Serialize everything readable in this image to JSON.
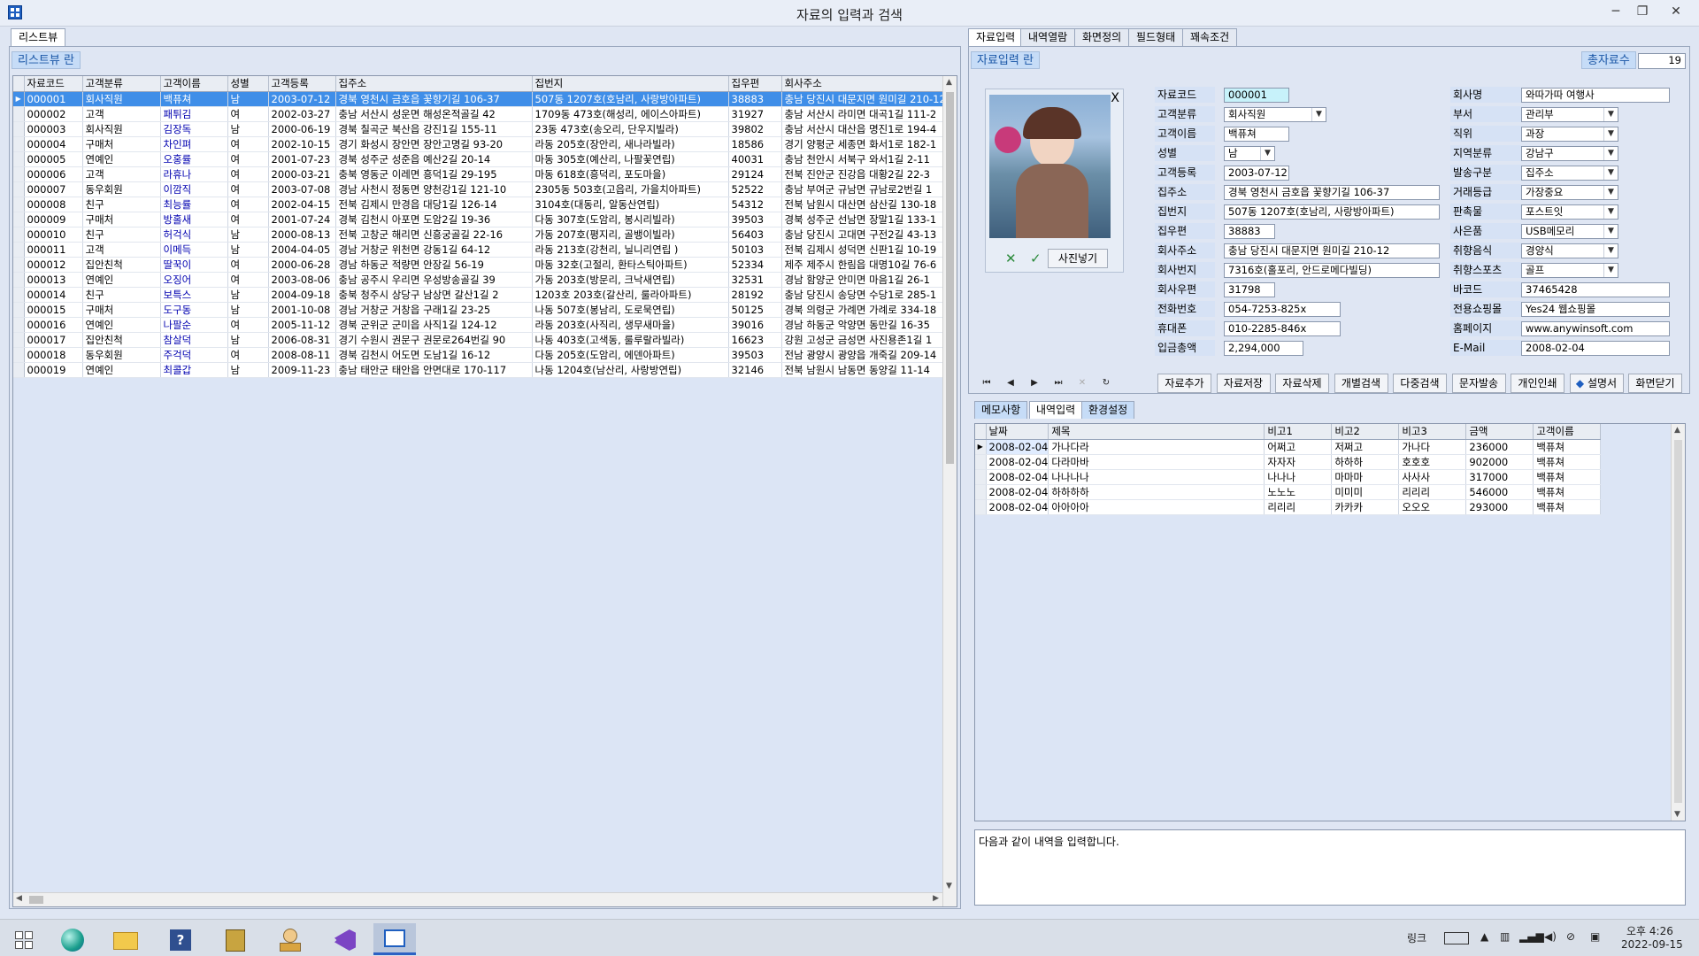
{
  "window": {
    "title": "자료의 입력과 검색",
    "controls": [
      "─",
      "❐",
      "✕"
    ]
  },
  "left": {
    "tab": "리스트뷰",
    "panel_label": "리스트뷰 란",
    "columns": [
      "자료코드",
      "고객분류",
      "고객이름",
      "성별",
      "고객등록",
      "집주소",
      "집번지",
      "집우편",
      "회사주소"
    ],
    "rows": [
      [
        "000001",
        "회사직원",
        "백퓨쳐",
        "남",
        "2003-07-12",
        "경북 영천시 금호읍 꽃향기길 106-37",
        "507동 1207호(호남리, 사랑방아파트)",
        "38883",
        "충남 당진시 대문지면 원미길 210-12"
      ],
      [
        "000002",
        "고객",
        "패튀김",
        "여",
        "2002-03-27",
        "충남 서산시 성운면 해성온적골길 42",
        "1709동 473호(해성리, 에이스아파트)",
        "31927",
        "충남 서산시 라미면 대곡1길 111-2"
      ],
      [
        "000003",
        "회사직원",
        "김장독",
        "남",
        "2000-06-19",
        "경북 칠곡군 북산읍 강진1길 155-11",
        "23동 473호(송오리, 단우지빌라)",
        "39802",
        "충남 서산시 대산읍 명진1로 194-4"
      ],
      [
        "000004",
        "구매처",
        "차인펴",
        "여",
        "2002-10-15",
        "경기 화성시 장안면 장안고명길 93-20",
        "라동 205호(장안리, 새나라빌라)",
        "18586",
        "경기 양평군 세종면 화서1로 182-1"
      ],
      [
        "000005",
        "연예인",
        "오홍률",
        "여",
        "2001-07-23",
        "경북 성주군 성준읍 예산2길 20-14",
        "마동 305호(예산리, 나팔꽃연립)",
        "40031",
        "충남 천안시 서북구 와서1길 2-11"
      ],
      [
        "000006",
        "고객",
        "라휴나",
        "여",
        "2000-03-21",
        "충북 영동군 이레면 흥덕1길 29-195",
        "마동 618호(흥덕리, 포도마을)",
        "29124",
        "전북 진안군 진강읍 대황2길 22-3"
      ],
      [
        "000007",
        "동우회원",
        "이깜직",
        "여",
        "2003-07-08",
        "경남 사천시 정동면 양천강1길 121-10",
        "2305동 503호(고읍리, 가을치아파트)",
        "52522",
        "충남 부여군 규남면 규남로2번길 1"
      ],
      [
        "000008",
        "친구",
        "최능률",
        "여",
        "2002-04-15",
        "전북 김제시 만경읍 대당1길 126-14",
        "3104호(대동리, 알동산연립)",
        "54312",
        "전북 남원시 대산면 삼산길 130-18"
      ],
      [
        "000009",
        "구매처",
        "방홀새",
        "여",
        "2001-07-24",
        "경북 김천시 아포면 도암2길 19-36",
        "다동 307호(도암리, 봉시리빌라)",
        "39503",
        "경북 성주군 선남면 장말1길 133-1"
      ],
      [
        "000010",
        "친구",
        "허걱식",
        "남",
        "2000-08-13",
        "전북 고창군 해리면 신흥궁골길 22-16",
        "가동 207호(평지리, 골뱅이빌라)",
        "56403",
        "충남 당진시 고대면 구전2길 43-13"
      ],
      [
        "000011",
        "고객",
        "이메득",
        "남",
        "2004-04-05",
        "경남 거창군 위천면 강동1길 64-12",
        "라동 213호(강천리, 닐니리연립 )",
        "50103",
        "전북 김제시 성덕면 신판1길 10-19"
      ],
      [
        "000012",
        "집안친척",
        "딸꾹이",
        "여",
        "2000-06-28",
        "경남 하동군 적량면 안장길 56-19",
        "마동 32호(고절리, 환타스틱아파트)",
        "52334",
        "제주 제주시 한림읍 대명10길 76-6"
      ],
      [
        "000013",
        "연예인",
        "오징어",
        "여",
        "2003-08-06",
        "충남 공주시 우리면 우성방송골길 39",
        "가동 203호(방문리, 크낙새연립)",
        "32531",
        "경남 함양군 안미면 마음1길 26-1"
      ],
      [
        "000014",
        "친구",
        "보특스",
        "남",
        "2004-09-18",
        "충북 청주시 상당구 남상면 갈산1길 2",
        "1203호 203호(갈산리, 룰라아파트)",
        "28192",
        "충남 당진시 송당면 수당1로 285-1"
      ],
      [
        "000015",
        "구매처",
        "도구동",
        "남",
        "2001-10-08",
        "경남 거창군 거창읍 구래1길 23-25",
        "나동 507호(봉남리, 도로묵연립)",
        "50125",
        "경북 의령군 가례면 가례로 334-18"
      ],
      [
        "000016",
        "연예인",
        "나팔순",
        "여",
        "2005-11-12",
        "경북 군위군 군미읍 사직1길 124-12",
        "라동 203호(사직리, 생무새마을)",
        "39016",
        "경남 하동군 악양면 동만길 16-35"
      ],
      [
        "000017",
        "집안친척",
        "참살덕",
        "남",
        "2006-08-31",
        "경기 수원시 권문구 권문로264번길 90",
        "나동 403호(고색동, 룰루랄라빌라)",
        "16623",
        "강원 고성군 금성면 사진용존1길 1"
      ],
      [
        "000018",
        "동우회원",
        "주걱덕",
        "여",
        "2008-08-11",
        "경북 김천시 어도면 도남1길 16-12",
        "다동 205호(도암리, 에덴아파트)",
        "39503",
        "전남 광양시 광양읍 개죽길 209-14"
      ],
      [
        "000019",
        "연예인",
        "최콜갑",
        "남",
        "2009-11-23",
        "충남 태안군 태안읍 안면대로 170-117",
        "나동 1204호(남산리, 사랑방연립)",
        "32146",
        "전북 남원시 남동면 동양길 11-14"
      ]
    ]
  },
  "right": {
    "tabs": [
      "자료입력",
      "내역열람",
      "화면정의",
      "필드형태",
      "꽤속조건"
    ],
    "panel_label": "자료입력 란",
    "total_label": "총자료수",
    "total_value": "19",
    "photo": {
      "close": "X",
      "cancel": "✕",
      "confirm": "✓",
      "insert_button": "사진넣기"
    },
    "fields_left": [
      {
        "label": "자료코드",
        "value": "000001",
        "type": "text"
      },
      {
        "label": "고객분류",
        "value": "회사직원",
        "type": "combo"
      },
      {
        "label": "고객이름",
        "value": "백퓨쳐",
        "type": "text"
      },
      {
        "label": "성별",
        "value": "남",
        "type": "combo"
      },
      {
        "label": "고객등록",
        "value": "2003-07-12",
        "type": "text"
      },
      {
        "label": "집주소",
        "value": "경북 영천시 금호읍 꽃향기길 106-37",
        "type": "text"
      },
      {
        "label": "집번지",
        "value": "507동 1207호(호남리, 사랑방아파트)",
        "type": "text"
      },
      {
        "label": "집우편",
        "value": "38883",
        "type": "text"
      },
      {
        "label": "회사주소",
        "value": "충남 당진시 대문지면 원미길 210-12",
        "type": "text"
      },
      {
        "label": "회사번지",
        "value": "7316호(홀포리, 안드로메다빌딩)",
        "type": "text"
      },
      {
        "label": "회사우편",
        "value": "31798",
        "type": "text"
      },
      {
        "label": "전화번호",
        "value": "054-7253-825x",
        "type": "text"
      },
      {
        "label": "휴대폰",
        "value": "010-2285-846x",
        "type": "text"
      },
      {
        "label": "입금총액",
        "value": "2,294,000",
        "type": "text"
      }
    ],
    "fields_right": [
      {
        "label": "회사명",
        "value": "와따가따 여행사",
        "type": "text"
      },
      {
        "label": "부서",
        "value": "관리부",
        "type": "combo"
      },
      {
        "label": "직위",
        "value": "과장",
        "type": "combo"
      },
      {
        "label": "지역분류",
        "value": "강남구",
        "type": "combo"
      },
      {
        "label": "발송구분",
        "value": "집주소",
        "type": "combo"
      },
      {
        "label": "거래등급",
        "value": "가장중요",
        "type": "combo"
      },
      {
        "label": "판촉물",
        "value": "포스트잇",
        "type": "combo"
      },
      {
        "label": "사은품",
        "value": "USB메모리",
        "type": "combo"
      },
      {
        "label": "취향음식",
        "value": "경양식",
        "type": "combo"
      },
      {
        "label": "취향스포츠",
        "value": "골프",
        "type": "combo"
      },
      {
        "label": "바코드",
        "value": "37465428",
        "type": "text"
      },
      {
        "label": "전용쇼핑몰",
        "value": "Yes24 웹쇼핑몰",
        "type": "text"
      },
      {
        "label": "홈페이지",
        "value": "www.anywinsoft.com",
        "type": "text"
      },
      {
        "label": "E-Mail",
        "value": "2008-02-04",
        "type": "text"
      }
    ],
    "nav_glyphs": [
      "⏮",
      "◀",
      "▶",
      "⏭",
      "✕",
      "↻"
    ],
    "action_buttons": [
      "자료추가",
      "자료저장",
      "자료삭제",
      "개별검색",
      "다중검색",
      "문자발송",
      "개인인쇄",
      "설명서",
      "화면닫기"
    ],
    "subtabs": [
      "메모사항",
      "내역입력",
      "환경설정"
    ],
    "memo_columns": [
      "날짜",
      "제목",
      "비고1",
      "비고2",
      "비고3",
      "금액",
      "고객이름"
    ],
    "memo_rows": [
      [
        "2008-02-04",
        "가나다라",
        "어쩌고",
        "저쩌고",
        "가나다",
        "236000",
        "백퓨쳐"
      ],
      [
        "2008-02-04",
        "다라마바",
        "자자자",
        "하하하",
        "호호호",
        "902000",
        "백퓨쳐"
      ],
      [
        "2008-02-04",
        "나나나나",
        "나나나",
        "마마마",
        "사사사",
        "317000",
        "백퓨쳐"
      ],
      [
        "2008-02-04",
        "하하하하",
        "노노노",
        "미미미",
        "리리리",
        "546000",
        "백퓨쳐"
      ],
      [
        "2008-02-04",
        "아아아아",
        "리리리",
        "카카카",
        "오오오",
        "293000",
        "백퓨쳐"
      ]
    ],
    "memo_text": "다음과 같이 내역을 입력합니다."
  },
  "taskbar": {
    "items": [
      "start-icon",
      "browser-icon",
      "file-explorer-icon",
      "help-icon",
      "archive-icon",
      "user-icon",
      "visual-studio-icon",
      "app-window-icon"
    ],
    "link_label": "링크",
    "time": "오후 4:26",
    "date": "2022-09-15"
  }
}
